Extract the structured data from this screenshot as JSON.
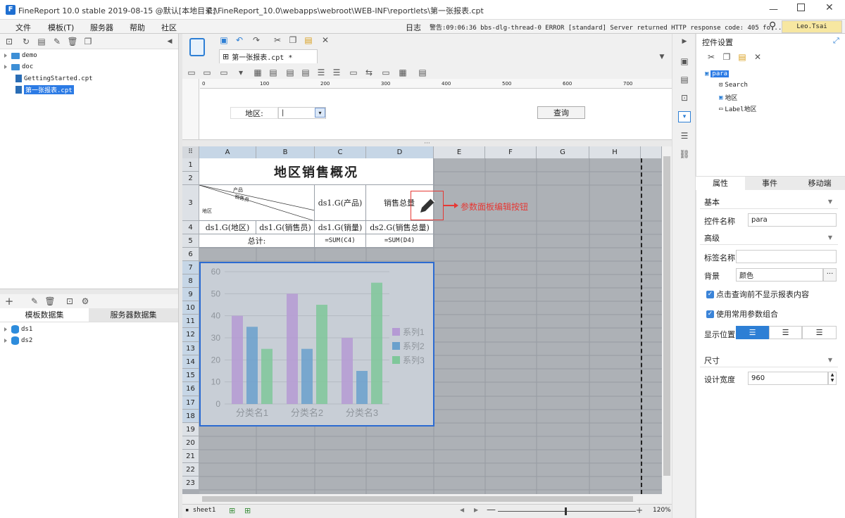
{
  "window": {
    "app_title": "FineReport 10.0 stable 2019-08-15 @默认[本地目录]",
    "path": "C:\\FineReport_10.0\\webapps\\webroot\\WEB-INF\\reportlets\\第一张报表.cpt"
  },
  "menu": [
    "文件",
    "模板(T)",
    "服务器",
    "帮助",
    "社区"
  ],
  "status": {
    "log": "日志",
    "warning": "警告:09:06:36 bbs-dlg-thread-0 ERROR [standard] Server returned HTTP response code: 405 fo...",
    "user": "Leo.Tsai"
  },
  "file_tree": [
    {
      "label": "demo",
      "type": "folder"
    },
    {
      "label": "doc",
      "type": "folder"
    },
    {
      "label": "GettingStarted.cpt",
      "type": "file"
    },
    {
      "label": "第一张报表.cpt",
      "type": "file",
      "selected": true
    }
  ],
  "datasets": {
    "tabs": [
      "模板数据集",
      "服务器数据集"
    ],
    "items": [
      "ds1",
      "ds2"
    ]
  },
  "editor": {
    "tab_title": "第一张报表.cpt *",
    "ruler_marks": [
      "0",
      "100",
      "200",
      "300",
      "400",
      "500",
      "600",
      "700"
    ],
    "param_label": "地区:",
    "query_button": "查询"
  },
  "sheet": {
    "columns": [
      "A",
      "B",
      "C",
      "D",
      "E",
      "F",
      "G",
      "H"
    ],
    "rows": [
      "1",
      "2",
      "3",
      "4",
      "5",
      "6",
      "7",
      "8",
      "9",
      "10",
      "11",
      "12",
      "13",
      "14",
      "15",
      "16",
      "17",
      "18",
      "19",
      "20",
      "21",
      "22",
      "23"
    ],
    "title": "地区销售概况",
    "diag_product": "产品",
    "diag_seller": "销售员",
    "diag_region": "地区",
    "c3": "ds1.G(产品)",
    "d3": "销售总量",
    "a4": "ds1.G(地区)",
    "b4": "ds1.G(销售员)",
    "c4": "ds1.G(销量)",
    "d4": "ds2.G(销售总量)",
    "a5": "总计:",
    "c5": "=SUM(C4)",
    "d5": "=SUM(D4)",
    "annotation": "参数面板编辑按钮",
    "sheet_tab": "sheet1",
    "zoom": "120%"
  },
  "chart_data": {
    "type": "bar",
    "categories": [
      "分类名1",
      "分类名2",
      "分类名3"
    ],
    "series": [
      {
        "name": "系列1",
        "values": [
          40,
          50,
          30
        ],
        "color": "#b59ad4"
      },
      {
        "name": "系列2",
        "values": [
          35,
          25,
          15
        ],
        "color": "#6aa0cc"
      },
      {
        "name": "系列3",
        "values": [
          25,
          45,
          55
        ],
        "color": "#7fc79a"
      }
    ],
    "yticks": [
      "60",
      "50",
      "40",
      "30",
      "20",
      "10",
      "0"
    ],
    "ylim": [
      0,
      60
    ],
    "legend": "right"
  },
  "right_panel": {
    "title": "控件设置",
    "widget_tree": [
      "para",
      "Search",
      "地区",
      "Label地区"
    ],
    "tabs": [
      "属性",
      "事件",
      "移动端"
    ],
    "basic_section": "基本",
    "widget_name_label": "控件名称",
    "widget_name_value": "para",
    "advanced_section": "高级",
    "tag_name_label": "标签名称",
    "background_label": "背景",
    "background_value": "颜色",
    "check1": "点击查询前不显示报表内容",
    "check2": "使用常用参数组合",
    "position_label": "显示位置",
    "size_section": "尺寸",
    "design_width_label": "设计宽度",
    "design_width_value": "960"
  }
}
